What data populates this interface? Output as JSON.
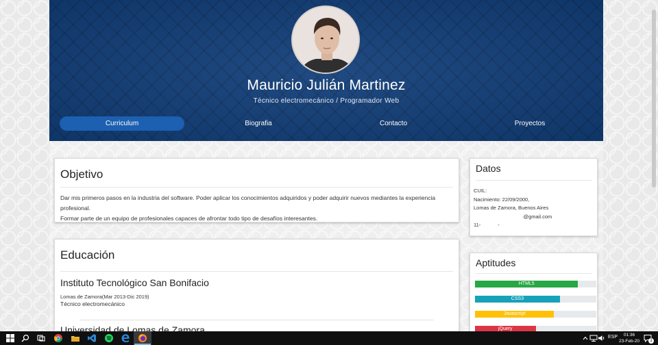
{
  "profile": {
    "name": "Mauricio Julián Martinez",
    "subtitle": "Técnico electromecánico / Programador Web"
  },
  "nav": {
    "tabs": [
      {
        "label": "Curriculum",
        "active": true
      },
      {
        "label": "Biografia",
        "active": false
      },
      {
        "label": "Contacto",
        "active": false
      },
      {
        "label": "Proyectos",
        "active": false
      }
    ]
  },
  "objetivo": {
    "title": "Objetivo",
    "line1": "Dar mis primeros pasos en la industria del software. Poder aplicar los conocimientos adquiridos y poder adquirir nuevos mediantes la experiencia profesional.",
    "line2": "Formar parte de un equipo de profesionales capaces de afrontar todo tipo de desafíos interesantes."
  },
  "educacion": {
    "title": "Educación",
    "items": [
      {
        "school": "Instituto Tecnológico San Bonifacio",
        "place_dates": "Lomas de Zamora(Mar 2013-Dic 2019)",
        "degree": "Técnico electromecánico"
      },
      {
        "school": "Universidad de Lomas de Zamora"
      }
    ]
  },
  "datos": {
    "title": "Datos",
    "cuil": "CUIL:",
    "nacimiento": "Nacimiento: 22/09/2000,",
    "ciudad": "Lomas de Zamora, Buenos Aires",
    "email": "@gmail.com",
    "phone_prefix": "11-",
    "phone_dash": "-"
  },
  "aptitudes": {
    "title": "Aptitudes",
    "skills": [
      {
        "name": "HTML5",
        "level": 0.85,
        "color": "#28a745"
      },
      {
        "name": "CSS3",
        "level": 0.7,
        "color": "#17a2b8"
      },
      {
        "name": "Javascript",
        "level": 0.65,
        "color": "#ffc107"
      },
      {
        "name": "jQuery",
        "level": 0.5,
        "color": "#dc3545"
      }
    ]
  },
  "taskbar": {
    "language": "ESP",
    "time": "01:36",
    "date": "23-Feb-20",
    "notification_count": "1"
  },
  "colors": {
    "header_blue": "#123f7a",
    "nav_active": "#1d5fb0"
  }
}
